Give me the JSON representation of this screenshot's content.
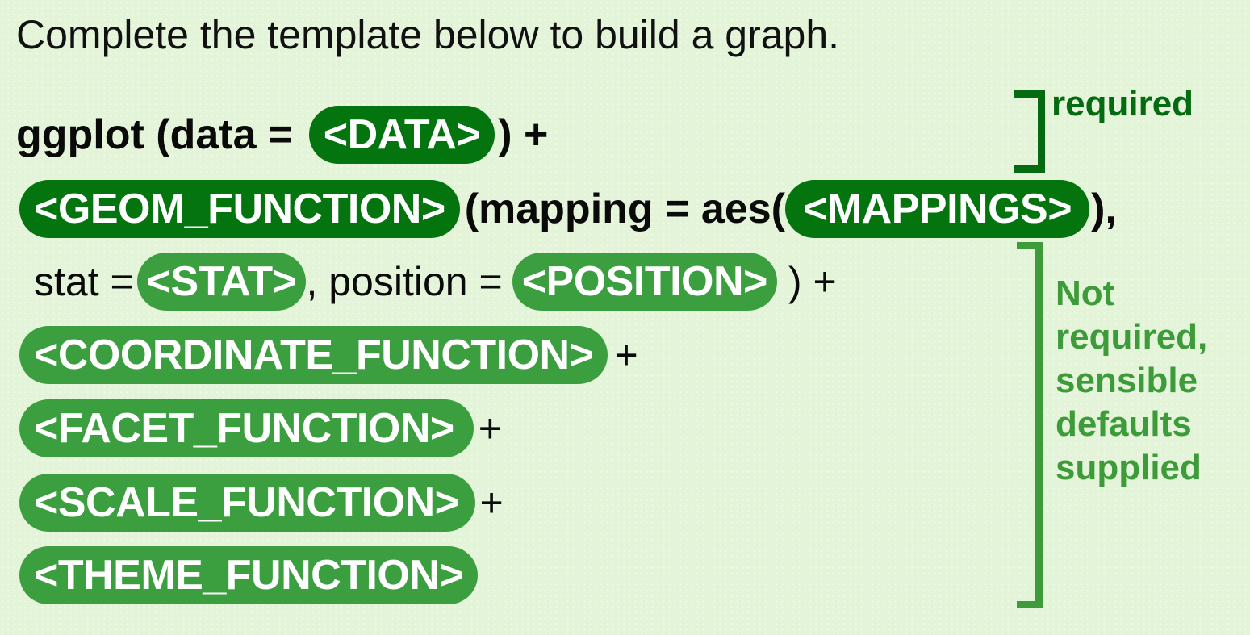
{
  "heading": "Complete the template below to build a graph.",
  "line1": {
    "prefix": "ggplot (data = ",
    "data_pill": "<DATA>",
    "suffix": ") +"
  },
  "line2": {
    "geom_pill": "<GEOM_FUNCTION>",
    "middle": "(mapping = aes(",
    "mappings_pill": "<MAPPINGS>",
    "suffix": "),"
  },
  "line3": {
    "stat_label": "stat =",
    "stat_pill": "<STAT>",
    "position_label": ", position =",
    "position_pill": "<POSITION>",
    "suffix": ") +"
  },
  "line4": {
    "pill": "<COORDINATE_FUNCTION>",
    "suffix": "+"
  },
  "line5": {
    "pill": "<FACET_FUNCTION>",
    "suffix": "+"
  },
  "line6": {
    "pill": "<SCALE_FUNCTION>",
    "suffix": "+"
  },
  "line7": {
    "pill": "<THEME_FUNCTION>"
  },
  "notes": {
    "required": "required",
    "optional_lines": [
      "Not",
      "required,",
      "sensible",
      "defaults",
      "supplied"
    ]
  },
  "colors": {
    "background": "#e3f4d9",
    "required_green": "#03740e",
    "optional_green": "#3c9f3f"
  }
}
